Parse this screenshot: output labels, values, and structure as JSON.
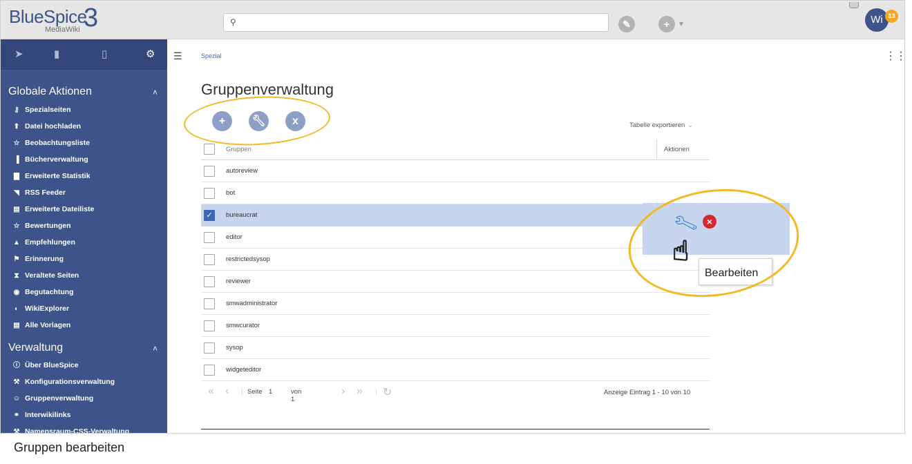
{
  "header": {
    "logo_main": "BlueSpice",
    "logo_sub": "MediaWiki",
    "logo_number": "3",
    "search_icon": "search-icon",
    "avatar_initials": "Wi",
    "notification_count": "13"
  },
  "sidebar": {
    "tabs": [
      "navigation-icon",
      "book-icon",
      "clipboard-icon",
      "gear-icon"
    ],
    "sections": [
      {
        "title": "Globale Aktionen",
        "items": [
          {
            "label": "Spezialseiten",
            "icon": "key-icon"
          },
          {
            "label": "Datei hochladen",
            "icon": "upload-icon"
          },
          {
            "label": "Beobachtungsliste",
            "icon": "star-icon"
          },
          {
            "label": "Bücherverwaltung",
            "icon": "books-icon"
          },
          {
            "label": "Erweiterte Statistik",
            "icon": "chart-icon"
          },
          {
            "label": "RSS Feeder",
            "icon": "rss-icon"
          },
          {
            "label": "Erweiterte Dateiliste",
            "icon": "list-icon"
          },
          {
            "label": "Bewertungen",
            "icon": "star-icon"
          },
          {
            "label": "Empfehlungen",
            "icon": "thumb-icon"
          },
          {
            "label": "Erinnerung",
            "icon": "flag-icon"
          },
          {
            "label": "Veraltete Seiten",
            "icon": "hourglass-icon"
          },
          {
            "label": "Begutachtung",
            "icon": "eye-icon"
          },
          {
            "label": "WikiExplorer",
            "icon": "explorer-icon"
          },
          {
            "label": "Alle Vorlagen",
            "icon": "template-icon"
          }
        ]
      },
      {
        "title": "Verwaltung",
        "items": [
          {
            "label": "Über BlueSpice",
            "icon": "info-icon"
          },
          {
            "label": "Konfigurationsverwaltung",
            "icon": "wrench-icon"
          },
          {
            "label": "Gruppenverwaltung",
            "icon": "group-icon"
          },
          {
            "label": "Interwikilinks",
            "icon": "link-icon"
          },
          {
            "label": "Namensraum-CSS-Verwaltung",
            "icon": "paint-icon"
          }
        ]
      }
    ]
  },
  "main": {
    "breadcrumb": "Spezial",
    "title": "Gruppenverwaltung",
    "toolbar": {
      "add": "+",
      "edit_icon": "wrench-icon",
      "remove": "x"
    },
    "export_label": "Tabelle exportieren",
    "columns": {
      "groups": "Gruppen",
      "actions": "Aktionen"
    },
    "rows": [
      {
        "name": "autoreview",
        "selected": false
      },
      {
        "name": "bot",
        "selected": false
      },
      {
        "name": "bureaucrat",
        "selected": true
      },
      {
        "name": "editor",
        "selected": false
      },
      {
        "name": "restrictedsysop",
        "selected": false
      },
      {
        "name": "reviewer",
        "selected": false
      },
      {
        "name": "smwadministrator",
        "selected": false
      },
      {
        "name": "smwcurator",
        "selected": false
      },
      {
        "name": "sysop",
        "selected": false
      },
      {
        "name": "widgeteditor",
        "selected": false
      }
    ],
    "pager": {
      "page_label": "Seite",
      "page": "1",
      "of_label": "von 1"
    },
    "display_info": "Anzeige Eintrag 1 - 10 von 10"
  },
  "callout": {
    "tooltip": "Bearbeiten"
  },
  "caption": "Gruppen bearbeiten",
  "colors": {
    "sidebar": "#3e5389",
    "selected_row": "#c8d5ee",
    "highlight": "#f3b824"
  }
}
